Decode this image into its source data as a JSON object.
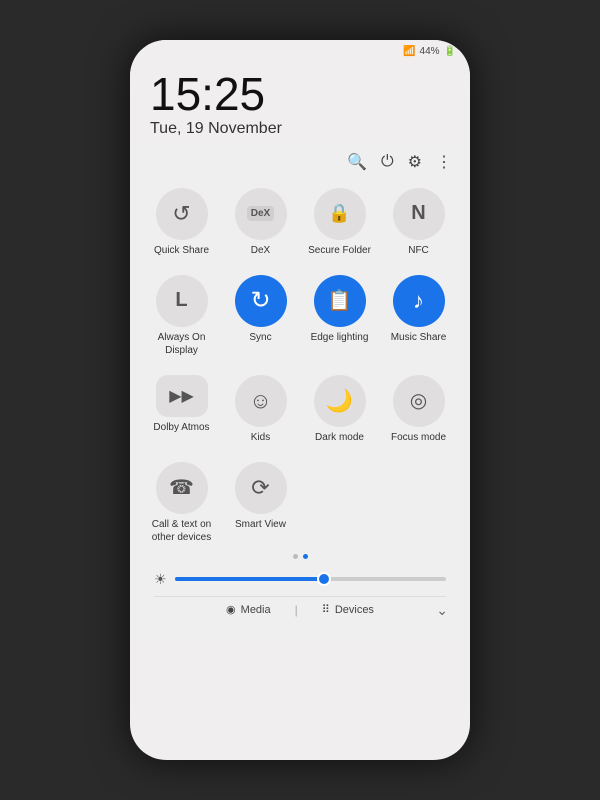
{
  "status": {
    "signal": "44%",
    "battery": "44%"
  },
  "clock": {
    "time": "15:25",
    "date": "Tue, 19 November"
  },
  "toolbar": {
    "search_icon": "🔍",
    "power_icon": "⏻",
    "settings_icon": "⚙",
    "more_icon": "⋮"
  },
  "tiles": [
    {
      "id": "quick-share",
      "label": "Quick Share",
      "icon": "↺",
      "active": false
    },
    {
      "id": "dex",
      "label": "DeX",
      "icon": "DeX",
      "active": false,
      "isDex": true
    },
    {
      "id": "secure-folder",
      "label": "Secure Folder",
      "icon": "🔒",
      "active": false
    },
    {
      "id": "nfc",
      "label": "NFC",
      "icon": "N",
      "active": false
    },
    {
      "id": "always-on-display",
      "label": "Always On Display",
      "icon": "L",
      "active": false
    },
    {
      "id": "sync",
      "label": "Sync",
      "icon": "↻",
      "active": true
    },
    {
      "id": "edge-lighting",
      "label": "Edge lighting",
      "icon": "📋",
      "active": true
    },
    {
      "id": "music-share",
      "label": "Music Share",
      "icon": "♪",
      "active": true
    },
    {
      "id": "dolby-atmos",
      "label": "Dolby Atmos",
      "icon": "▶",
      "active": false,
      "isWide": true
    },
    {
      "id": "kids",
      "label": "Kids",
      "icon": "☺",
      "active": false
    },
    {
      "id": "dark-mode",
      "label": "Dark mode",
      "icon": "🌙",
      "active": false
    },
    {
      "id": "focus-mode",
      "label": "Focus mode",
      "icon": "◎",
      "active": false
    },
    {
      "id": "call-text",
      "label": "Call & text on other devices",
      "icon": "☎",
      "active": false
    },
    {
      "id": "smart-view",
      "label": "Smart View",
      "icon": "⟳",
      "active": false
    }
  ],
  "brightness": {
    "value": 55
  },
  "page_dots": [
    {
      "active": false
    },
    {
      "active": true
    }
  ],
  "bottom_bar": {
    "media_label": "Media",
    "devices_label": "Devices",
    "media_icon": "◉",
    "devices_icon": "⠿"
  }
}
